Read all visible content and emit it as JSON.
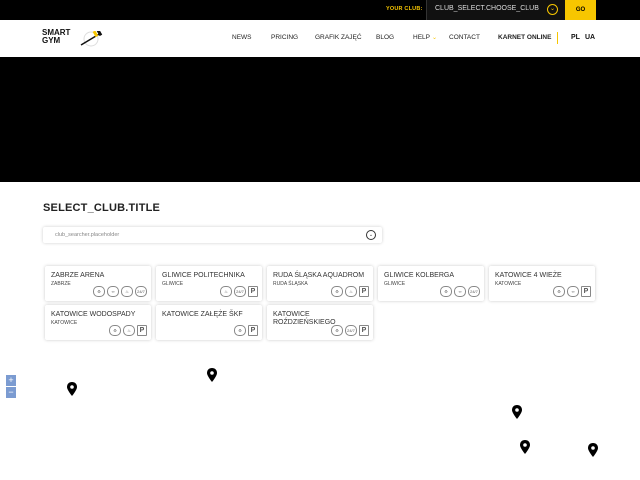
{
  "topbar": {
    "your_club_label": "YOUR CLUB:",
    "club_select_value": "CLUB_SELECT.CHOOSE_CLUB",
    "go_label": "GO"
  },
  "header": {
    "logo_line1": "SMART",
    "logo_line2": "GYM",
    "nav": [
      "NEWS",
      "PRICING",
      "GRAFIK ZAJĘĆ",
      "BLOG",
      "HELP",
      "CONTACT"
    ],
    "karnet_label": "KARNET ONLINE",
    "languages": [
      "PL",
      "UA"
    ]
  },
  "main": {
    "title": "SELECT_CLUB.TITLE",
    "search_placeholder": "club_searcher.placeholder"
  },
  "clubs": [
    {
      "name": "ZABRZE ARENA",
      "city": "ZABRZE",
      "icons": [
        "machine-icon",
        "bike-icon",
        "sauna-icon",
        "24-7-icon"
      ]
    },
    {
      "name": "GLIWICE POLITECHNIKA",
      "city": "GLIWICE",
      "icons": [
        "sauna-icon",
        "24-7-icon",
        "parking-icon"
      ]
    },
    {
      "name": "RUDA ŚLĄSKA AQUADROM",
      "city": "RUDA ŚLĄSKA",
      "icons": [
        "machine-icon",
        "sauna-icon",
        "parking-icon"
      ]
    },
    {
      "name": "GLIWICE KOLBERGA",
      "city": "GLIWICE",
      "icons": [
        "machine-icon",
        "bike-icon",
        "24-7-icon"
      ]
    },
    {
      "name": "KATOWICE 4 WIEŻE",
      "city": "KATOWICE",
      "icons": [
        "machine-icon",
        "bike-icon",
        "parking-icon"
      ]
    },
    {
      "name": "KATOWICE WODOSPADY",
      "city": "KATOWICE",
      "icons": [
        "machine-icon",
        "sauna-icon",
        "parking-icon"
      ]
    },
    {
      "name": "KATOWICE ZAŁĘŻE ŠKF",
      "city": "",
      "icons": [
        "machine-icon",
        "parking-icon"
      ]
    },
    {
      "name": "KATOWICE ROŹDZIEŃSKIEGO",
      "city": "",
      "icons": [
        "machine-icon",
        "24-7-icon",
        "parking-icon"
      ]
    }
  ],
  "map": {
    "zoom_in": "+",
    "zoom_out": "−"
  },
  "colors": {
    "accent": "#f7c600",
    "dark": "#000000",
    "zoom": "#7b9bd1"
  }
}
